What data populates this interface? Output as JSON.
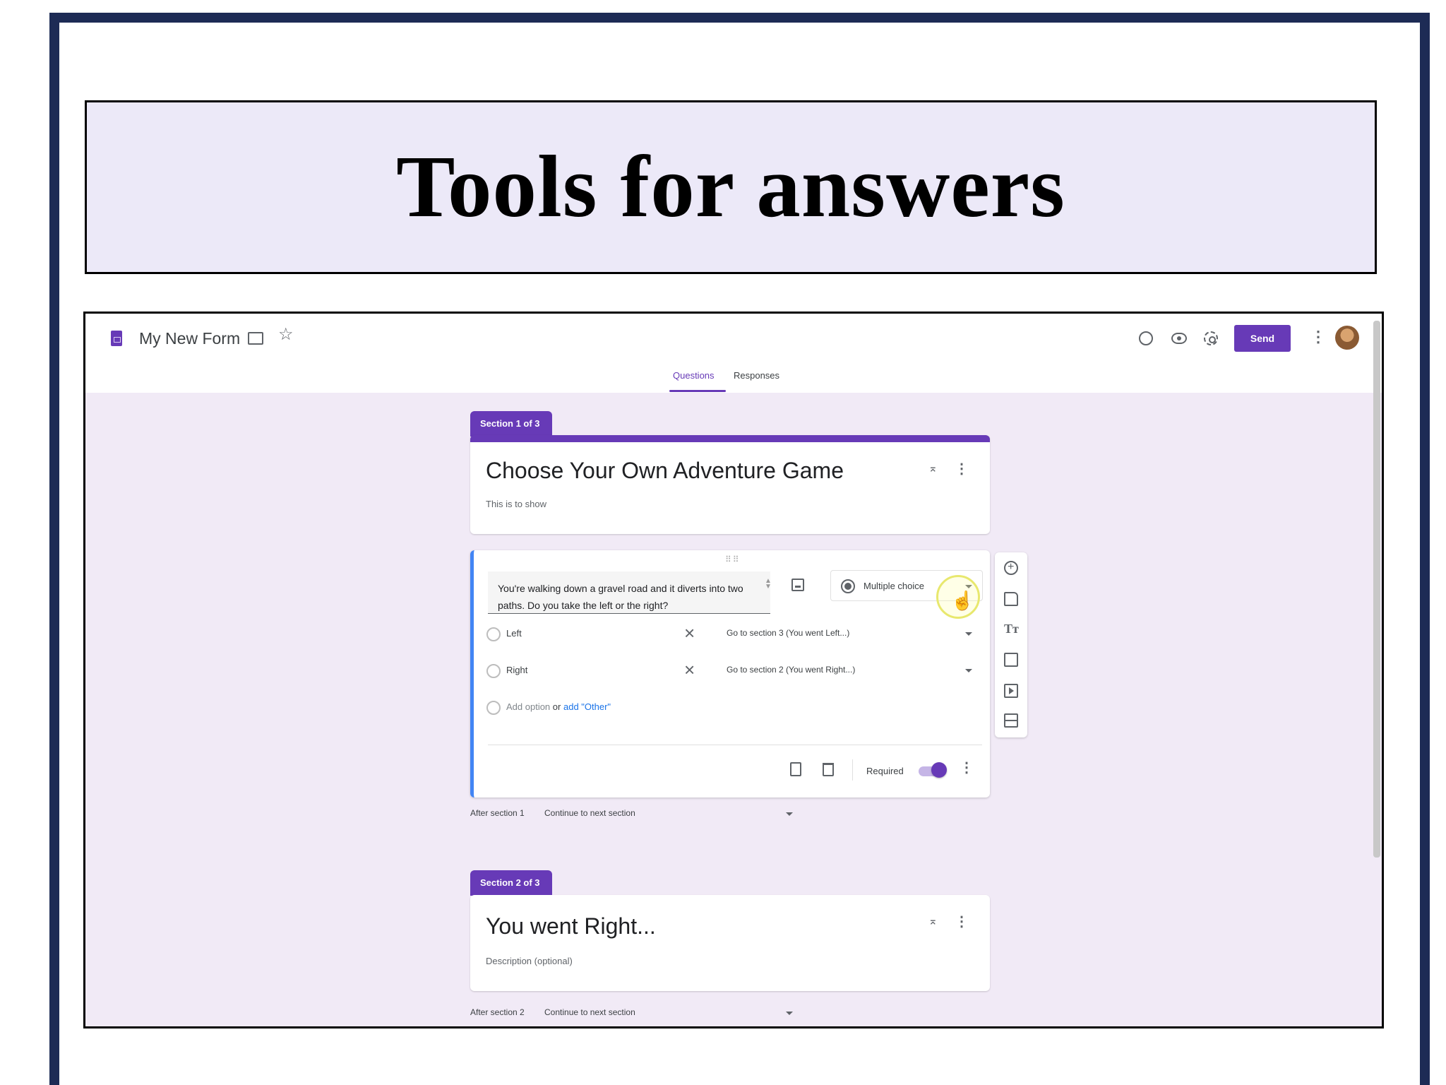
{
  "slide": {
    "title": "Tools for answers"
  },
  "app": {
    "form_name": "My New Form",
    "send_label": "Send",
    "tabs": [
      "Questions",
      "Responses"
    ]
  },
  "section1": {
    "tab_label": "Section 1 of 3",
    "title": "Choose Your Own Adventure Game",
    "description": "This is to show",
    "after_label": "After section 1",
    "after_value": "Continue to next section"
  },
  "question": {
    "text": "You're walking down a gravel road and it diverts into two paths. Do you take the left or the right?",
    "type": "Multiple choice",
    "options": [
      {
        "label": "Left",
        "goto": "Go to section 3 (You went Left...)"
      },
      {
        "label": "Right",
        "goto": "Go to section 2 (You went Right...)"
      }
    ],
    "add_option": "Add option",
    "or_label": "or",
    "add_other": "add \"Other\"",
    "required_label": "Required",
    "required": true
  },
  "section2": {
    "tab_label": "Section 2 of 3",
    "title": "You went Right...",
    "description": "Description (optional)",
    "after_label": "After section 2",
    "after_value": "Continue to next section"
  },
  "colors": {
    "accent": "#673ab7",
    "focus": "#4285f4",
    "frame": "#1d2b55",
    "title_bg": "#ece9f8"
  }
}
